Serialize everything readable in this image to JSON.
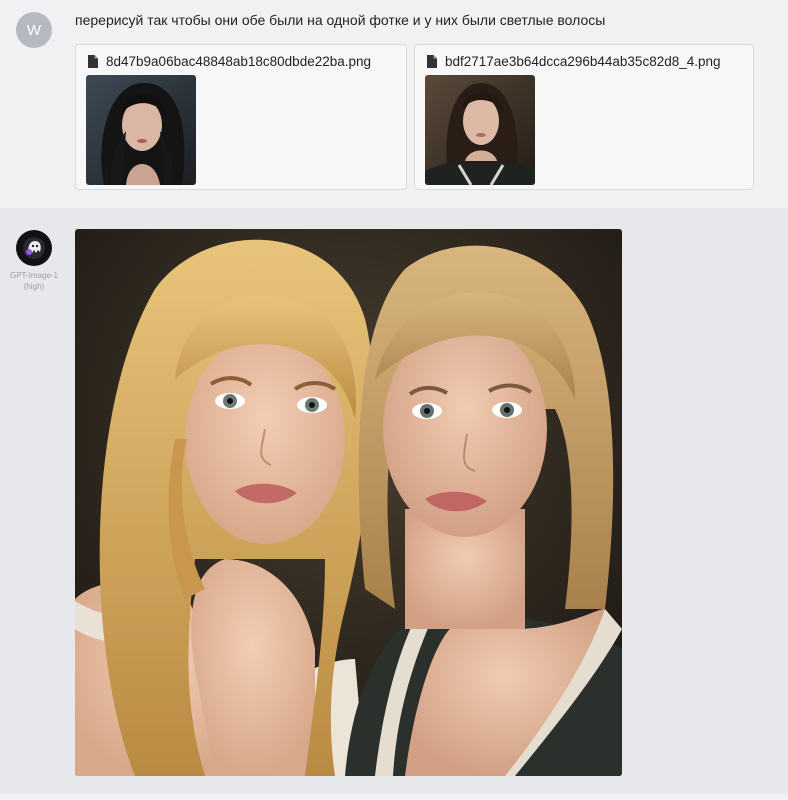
{
  "user_message": {
    "avatar_letter": "W",
    "text": "перерисуй так чтобы они обе были на одной фотке и у них были светлые волосы",
    "attachments": [
      {
        "filename": "8d47b9a06bac48848ab18c80dbde22ba.png",
        "icon": "file-icon"
      },
      {
        "filename": "bdf2717ae3b64dcca296b44ab35c82d8_4.png",
        "icon": "file-icon"
      }
    ]
  },
  "bot_message": {
    "model_name_line1": "GPT-Image-1",
    "model_name_line2": "(high)",
    "avatar_icon": "ghost-icon"
  },
  "colors": {
    "user_bg": "#f0f1f3",
    "bot_bg": "#e7e8ec",
    "attachment_border": "#d8d9dd"
  }
}
